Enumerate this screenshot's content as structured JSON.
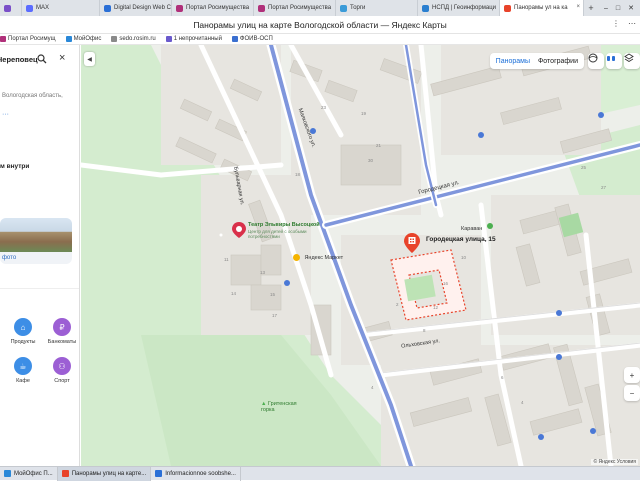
{
  "browser": {
    "tabs": [
      {
        "label": "",
        "color": "#7a4fc8",
        "active": false
      },
      {
        "label": "MAX",
        "color": "#5b6cff",
        "active": false
      },
      {
        "label": "Digital Design Web Clie",
        "color": "#2a6fd6",
        "active": false
      },
      {
        "label": "Портал Росимущества",
        "color": "#b0307a",
        "active": false
      },
      {
        "label": "Портал Росимущества",
        "color": "#b0307a",
        "active": false
      },
      {
        "label": "Торги",
        "color": "#3a9bd8",
        "active": false
      },
      {
        "label": "НСПД | Геоинформаци",
        "color": "#2a7fd0",
        "active": false
      },
      {
        "label": "Панорамы ул на ка",
        "color": "#e8432a",
        "active": true
      }
    ],
    "new_tab": "+",
    "window_controls": [
      "–",
      "□",
      "✕"
    ],
    "page_title": "Панорамы улиц на карте Вологодской области — Яндекс Карты",
    "title_menu": [
      "⋮",
      "⋯"
    ],
    "bookmarks": [
      {
        "label": "Портал Росимущ",
        "color": "#b0307a"
      },
      {
        "label": "МойОфис",
        "color": "#2a88d8"
      },
      {
        "label": "sedo.rosim.ru",
        "color": "#8a8a8a"
      },
      {
        "label": "1 непрочитанный",
        "color": "#6a5acd"
      },
      {
        "label": "ФОИВ-ОСП",
        "color": "#3a6fd0"
      }
    ]
  },
  "sidebar": {
    "search_query": "Череповец",
    "region_text": "Вологодская область,",
    "more_dots": "···",
    "inside_label": "м внутри",
    "photo_more": "фото",
    "categories": [
      {
        "label": "Продукты",
        "color": "#3d8ee6",
        "icon": "basket-icon",
        "glyph": "⌂"
      },
      {
        "label": "Банкоматы",
        "color": "#9c5fd4",
        "icon": "ruble-icon",
        "glyph": "₽"
      },
      {
        "label": "Кафе",
        "color": "#3d8ee6",
        "icon": "cup-icon",
        "glyph": "☕"
      },
      {
        "label": "Спорт",
        "color": "#9c5fd4",
        "icon": "sport-icon",
        "glyph": "⚇"
      }
    ]
  },
  "map": {
    "layers": {
      "panoramas": "Панорамы",
      "photos": "Фотографии"
    },
    "zoom_in": "+",
    "zoom_out": "−",
    "streets": {
      "gorodetskaya": "Городецкая ул.",
      "mayakovskogo": "Маяковского ул.",
      "olkhovskaya": "Ольховская ул.",
      "bulvar": "Бульварная ул."
    },
    "poi": {
      "theatre_title": "Театр Эльвиры Высоцкой",
      "theatre_sub": "Центр для детей с особыми потребностями",
      "yandex_market": "Яндекс Маркет",
      "karavan": "Караван",
      "gritsenskaya": "Гритенская горка",
      "address": "Городецкая улица, 15"
    },
    "house_numbers": [
      "19",
      "21",
      "23",
      "30",
      "18",
      "13",
      "15",
      "17",
      "11",
      "14",
      "2",
      "8",
      "16",
      "12",
      "6",
      "4",
      "25",
      "27",
      "4",
      "10"
    ],
    "colors": {
      "road": "#ffffff",
      "major_road": "#8ea2e0",
      "park": "#d5ecd0",
      "building": "#e3e1dc",
      "marker": "#e8432a"
    },
    "copyright": "© Яндекс  Условия"
  },
  "taskbar": [
    {
      "label": "МойОфис П...",
      "color": "#2a88d8",
      "active": false
    },
    {
      "label": "Панорамы улиц на карте...",
      "color": "#e8432a",
      "active": true
    },
    {
      "label": "Informacionnoe soobshe...",
      "color": "#2a6fd6",
      "active": false
    }
  ]
}
